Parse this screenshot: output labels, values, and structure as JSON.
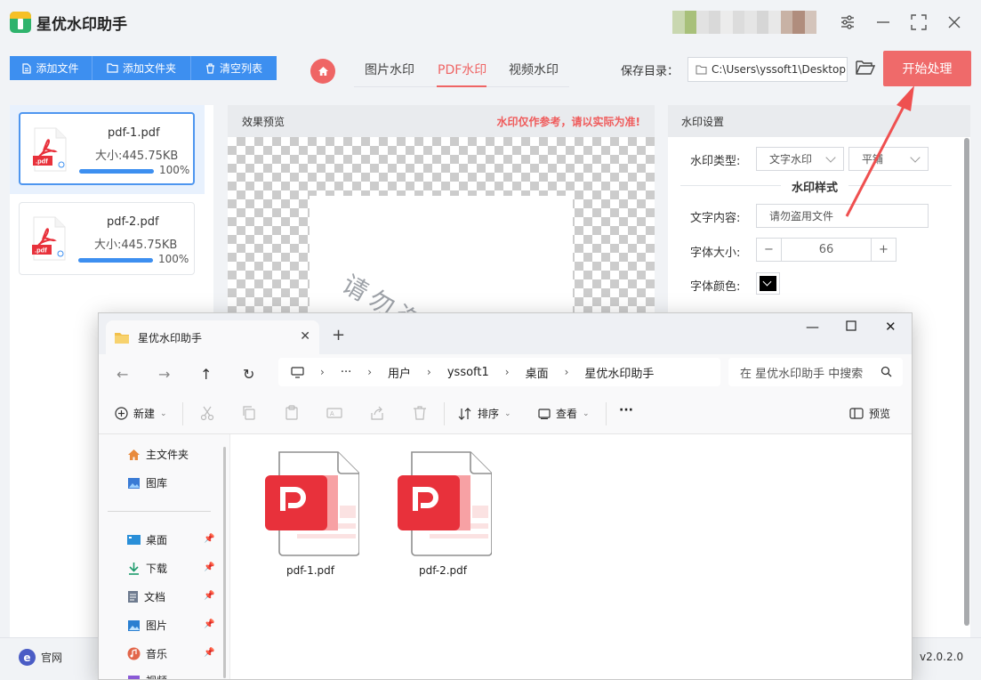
{
  "app": {
    "title": "星优水印助手",
    "window_controls": [
      "settings",
      "minimize",
      "maximize",
      "close"
    ]
  },
  "toolbar": {
    "add_file": "添加文件",
    "add_folder": "添加文件夹",
    "clear_list": "清空列表",
    "tabs": [
      "图片水印",
      "PDF水印",
      "视频水印"
    ],
    "active_tab": "PDF水印",
    "save_label": "保存目录：",
    "save_path": "C:\\Users\\yssoft1\\Desktop",
    "start": "开始处理"
  },
  "files": [
    {
      "name": "pdf-1.pdf",
      "size": "大小:445.75KB",
      "progress": 100,
      "progress_text": "100%",
      "selected": true
    },
    {
      "name": "pdf-2.pdf",
      "size": "大小:445.75KB",
      "progress": 100,
      "progress_text": "100%",
      "selected": false
    }
  ],
  "preview": {
    "title": "效果预览",
    "warning": "水印仅作参考，请以实际为准!",
    "watermark_text": "请勿盗用文件"
  },
  "settings": {
    "title": "水印设置",
    "type_label": "水印类型:",
    "type_value": "文字水印",
    "layout_value": "平铺",
    "style_title": "水印样式",
    "text_label": "文字内容:",
    "text_value": "请勿盗用文件",
    "font_size_label": "字体大小:",
    "font_size_value": "66",
    "font_color_label": "字体颜色:",
    "font_color": "#000000"
  },
  "status": {
    "site": "官网",
    "version": "v2.0.2.0"
  },
  "explorer": {
    "tab_title": "星优水印助手",
    "breadcrumb": [
      "用户",
      "yssoft1",
      "桌面",
      "星优水印助手"
    ],
    "search_placeholder": "在 星优水印助手 中搜索",
    "commands": {
      "new": "新建",
      "sort": "排序",
      "view": "查看",
      "more": "···",
      "preview": "预览"
    },
    "sidebar": [
      {
        "label": "主文件夹",
        "icon": "home-icon"
      },
      {
        "label": "图库",
        "icon": "gallery-icon"
      },
      {
        "label": "桌面",
        "icon": "desktop-icon",
        "pinned": true
      },
      {
        "label": "下载",
        "icon": "download-icon",
        "pinned": true
      },
      {
        "label": "文档",
        "icon": "document-icon",
        "pinned": true
      },
      {
        "label": "图片",
        "icon": "pictures-icon",
        "pinned": true
      },
      {
        "label": "音乐",
        "icon": "music-icon",
        "pinned": true
      },
      {
        "label": "视频",
        "icon": "video-icon",
        "pinned": true
      }
    ],
    "files": [
      {
        "name": "pdf-1.pdf"
      },
      {
        "name": "pdf-2.pdf"
      }
    ]
  },
  "colors": {
    "accent_blue": "#3d8ff0",
    "accent_red": "#ef6565",
    "pdf_red": "#e8313b"
  }
}
